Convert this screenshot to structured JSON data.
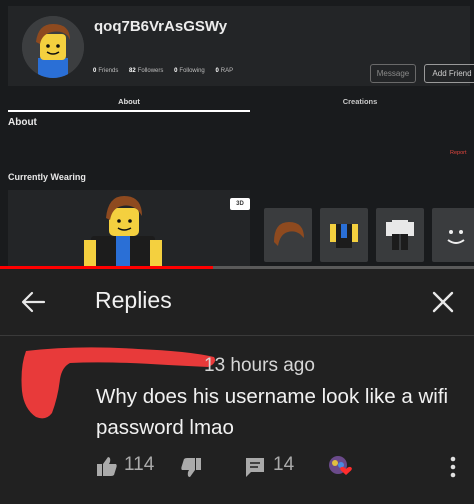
{
  "profile": {
    "username": "qoq7B6VrAsGSWy",
    "stats": [
      {
        "value": "0",
        "label": "Friends"
      },
      {
        "value": "82",
        "label": "Followers"
      },
      {
        "value": "0",
        "label": "Following"
      },
      {
        "value": "0",
        "label": "RAP"
      }
    ],
    "message_button": "Message",
    "add_friend_button": "Add Friend",
    "tabs": [
      "About",
      "Creations"
    ],
    "about_heading": "About",
    "report_link": "Report",
    "currently_wearing_heading": "Currently Wearing",
    "view_3d_button": "3D",
    "worn_items": [
      "hair-item",
      "shirt-item",
      "pants-item",
      "face-item"
    ]
  },
  "video_progress": 0.45,
  "replies_sheet": {
    "title": "Replies",
    "back_icon": "arrow-left-icon",
    "close_icon": "close-icon",
    "comment": {
      "author_redacted": true,
      "time": "13 hours ago",
      "text": "Why does his username look like a wifi password lmao",
      "likes": "114",
      "replies": "14"
    },
    "icons": [
      "thumb-up-icon",
      "thumb-down-icon",
      "reply-icon",
      "creator-heart-icon",
      "more-vert-icon"
    ]
  },
  "colors": {
    "background": "#191b1d",
    "sheet": "#212121",
    "accent_red": "#ff0000",
    "report_red": "#e2463e",
    "redaction_red": "#e83a3a"
  }
}
